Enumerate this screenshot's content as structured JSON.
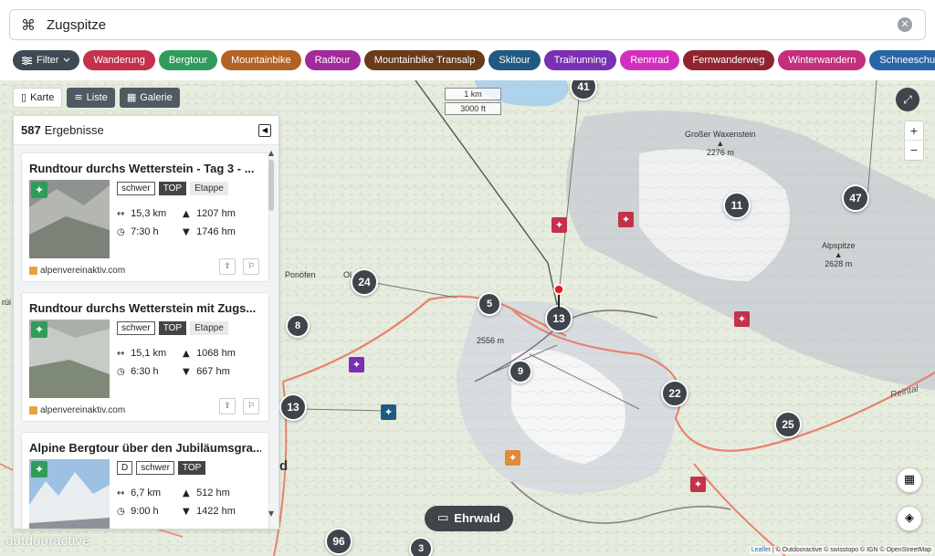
{
  "search": {
    "cmd_icon": "command-icon",
    "value": "Zugspitze",
    "clear_icon": "clear-icon"
  },
  "filter": {
    "label": "Filter",
    "icon": "sliders-icon",
    "chevron": "chevron-down-icon"
  },
  "categories": [
    {
      "label": "Wanderung",
      "color": "#c4314b"
    },
    {
      "label": "Bergtour",
      "color": "#2f9c5b"
    },
    {
      "label": "Mountainbike",
      "color": "#b26224"
    },
    {
      "label": "Radtour",
      "color": "#a22a9b"
    },
    {
      "label": "Mountainbike Transalp",
      "color": "#6a3b1b"
    },
    {
      "label": "Skitour",
      "color": "#215a80"
    },
    {
      "label": "Trailrunning",
      "color": "#7b2fb3"
    },
    {
      "label": "Rennrad",
      "color": "#d32fbf"
    },
    {
      "label": "Fernwanderweg",
      "color": "#8f2430"
    },
    {
      "label": "Winterwandern",
      "color": "#c42e7e"
    },
    {
      "label": "Schneeschuh",
      "color": "#2a65a7"
    }
  ],
  "views": {
    "map": "Karte",
    "list": "Liste",
    "gallery": "Galerie"
  },
  "results": {
    "count": "587",
    "label": "Ergebnisse"
  },
  "cards": [
    {
      "title": "Rundtour durchs Wetterstein - Tag 3 - ...",
      "difficulty": "schwer",
      "top": "TOP",
      "extra": "Etappe",
      "distance": "15,3 km",
      "ascent": "1207 hm",
      "duration": "7:30 h",
      "descent": "1746 hm",
      "source": "alpenvereinaktiv.com",
      "badge_color": "#2f9c5b"
    },
    {
      "title": "Rundtour durchs Wetterstein mit Zugs...",
      "difficulty": "schwer",
      "top": "TOP",
      "extra": "Etappe",
      "distance": "15,1 km",
      "ascent": "1068 hm",
      "duration": "6:30 h",
      "descent": "667 hm",
      "source": "alpenvereinaktiv.com",
      "badge_color": "#2f9c5b"
    },
    {
      "title": "Alpine Bergtour über den Jubiläumsgra...",
      "grade": "D",
      "difficulty": "schwer",
      "top": "TOP",
      "distance": "6,7 km",
      "ascent": "512 hm",
      "duration": "9:00 h",
      "descent": "1422 hm",
      "badge_color": "#2f9c5b"
    }
  ],
  "map": {
    "scale_km": "1 km",
    "scale_ft": "3000 ft",
    "clusters": [
      "41",
      "11",
      "47",
      "24",
      "5",
      "13",
      "8",
      "9",
      "22",
      "13",
      "25",
      "96",
      "3"
    ],
    "peaks": [
      {
        "name": "Großer Waxenstein",
        "height": "2276 m"
      },
      {
        "name": "Alpspitze",
        "height": "2628 m"
      }
    ],
    "elevation_label": "2556 m",
    "places": [
      "Ponöfen",
      "Ol",
      "rüi",
      "d",
      "Reintal"
    ],
    "location_button": "Ehrwald",
    "zoom_in": "+",
    "zoom_out": "−",
    "logo": "outdooractive",
    "attribution": {
      "leaflet": "Leaflet",
      "rest": "| © Outdooractive © swisstopo © IGN © OpenStreetMap"
    }
  }
}
